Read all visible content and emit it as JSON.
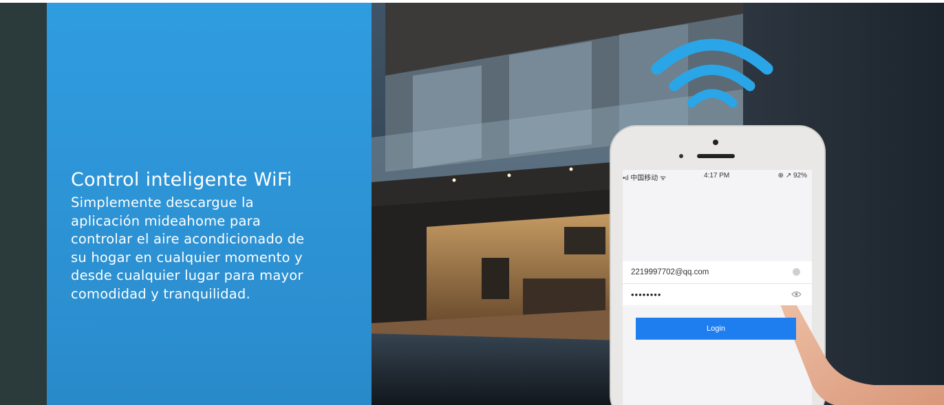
{
  "banner": {
    "headline": "Control inteligente WiFi",
    "body_lines": [
      "Simplemente descargue la",
      "aplicación mideahome para",
      "controlar el aire acondicionado de",
      "su hogar en cualquier momento y",
      "desde cualquier lugar para mayor",
      "comodidad y tranquilidad."
    ]
  },
  "phone": {
    "status_carrier": "•ıl 中国移动 ᯤ",
    "status_time": "4:17 PM",
    "status_right": "⊕ ↗ 92%",
    "email_value": "2219997702@qq.com",
    "password_value": "••••••••",
    "login_label": "Login"
  },
  "colors": {
    "overlay_blue": "#2e9be0",
    "button_blue": "#1e7ef0",
    "wifi_blue": "#2aa6e8"
  },
  "icons": [
    "wifi-icon",
    "clear-icon",
    "eye-icon",
    "pointing-finger-icon"
  ]
}
